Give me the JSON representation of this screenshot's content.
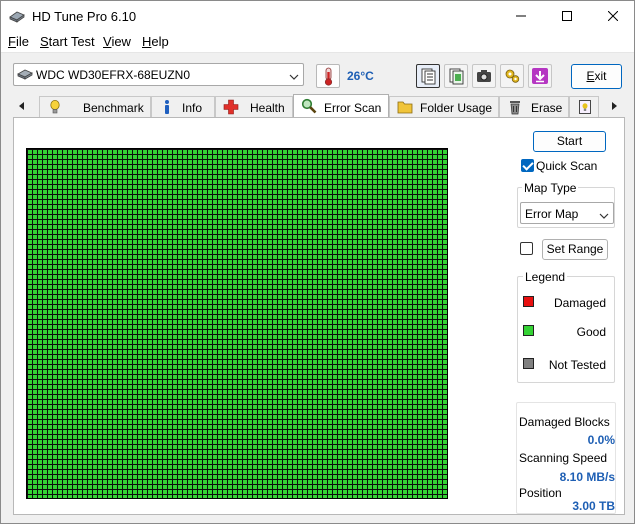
{
  "window": {
    "title": "HD Tune Pro 6.10"
  },
  "menu": {
    "file": {
      "hotkey": "F",
      "rest": "ile"
    },
    "start_test": {
      "hotkey": "S",
      "rest": "tart Test"
    },
    "view": {
      "hotkey": "V",
      "rest": "iew"
    },
    "help": {
      "hotkey": "H",
      "rest": "elp"
    }
  },
  "toolbar": {
    "drive": "WDC WD30EFRX-68EUZN0",
    "temperature": "26°C",
    "exit_label": "Exit",
    "exit_hotkey": "E",
    "exit_rest": "xit"
  },
  "tabs": [
    {
      "label": "Benchmark",
      "icon": "bulb-icon"
    },
    {
      "label": "Info",
      "icon": "info-icon"
    },
    {
      "label": "Health",
      "icon": "health-cross-icon"
    },
    {
      "label": "Error Scan",
      "icon": "magnifier-icon",
      "active": true
    },
    {
      "label": "Folder Usage",
      "icon": "folder-icon"
    },
    {
      "label": "Erase",
      "icon": "trash-icon"
    }
  ],
  "controls": {
    "start_label": "Start",
    "quick_scan_label": "Quick Scan",
    "quick_scan_checked": true,
    "map_type_title": "Map Type",
    "map_type_value": "Error Map",
    "set_range_label": "Set Range",
    "set_range_checked": false
  },
  "legend": {
    "title": "Legend",
    "items": [
      {
        "label": "Damaged",
        "color": "#e81010"
      },
      {
        "label": "Good",
        "color": "#34d234"
      },
      {
        "label": "Not Tested",
        "color": "#808080"
      }
    ]
  },
  "stats": {
    "damaged_blocks_label": "Damaged Blocks",
    "damaged_blocks_value": "0.0%",
    "scanning_speed_label": "Scanning Speed",
    "scanning_speed_value": "8.10 MB/s",
    "position_label": "Position",
    "position_value": "3.00 TB"
  },
  "colors": {
    "accent": "#0067c0",
    "value_blue": "#1e5fb4",
    "good_block": "#34d234"
  }
}
